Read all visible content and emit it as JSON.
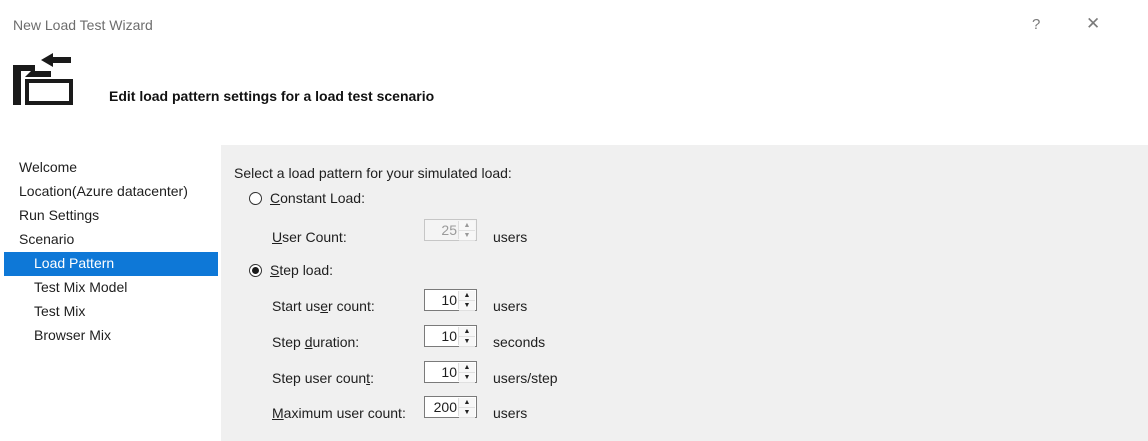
{
  "window": {
    "title": "New Load Test Wizard",
    "help_glyph": "?",
    "close_glyph": "✕"
  },
  "header": {
    "text": "Edit load pattern settings for a load test scenario",
    "icon": "wizard-folder-arrow-icon"
  },
  "nav": {
    "items": [
      {
        "label": "Welcome"
      },
      {
        "label": "Location(Azure datacenter)"
      },
      {
        "label": "Run Settings"
      },
      {
        "label": "Scenario"
      },
      {
        "label": "Load Pattern",
        "selected": true
      },
      {
        "label": "Test Mix Model"
      },
      {
        "label": "Test Mix"
      },
      {
        "label": "Browser Mix"
      }
    ],
    "selected_color": "#0e78d7"
  },
  "panel": {
    "prompt": "Select a load pattern for your simulated load:",
    "constant": {
      "radio_label_prefix": "C",
      "radio_label_rest": "onstant Load:",
      "selected": false,
      "user_count_label_prefix": "U",
      "user_count_label_rest": "ser Count:",
      "user_count_value": "25",
      "user_count_unit": "users"
    },
    "step": {
      "radio_label_prefix": "S",
      "radio_label_rest": "tep load:",
      "selected": true,
      "start": {
        "label_a": "Start us",
        "label_u": "e",
        "label_b": "r count:",
        "value": "10",
        "unit": "users"
      },
      "duration": {
        "label_a": "Step ",
        "label_u": "d",
        "label_b": "uration:",
        "value": "10",
        "unit": "seconds"
      },
      "step_count": {
        "label_a": "Step user coun",
        "label_u": "t",
        "label_b": ":",
        "value": "10",
        "unit": "users/step"
      },
      "max": {
        "label_a": "",
        "label_u": "M",
        "label_b": "aximum user count:",
        "value": "200",
        "unit": "users"
      }
    },
    "spinner_up_glyph": "▲",
    "spinner_down_glyph": "▼"
  }
}
